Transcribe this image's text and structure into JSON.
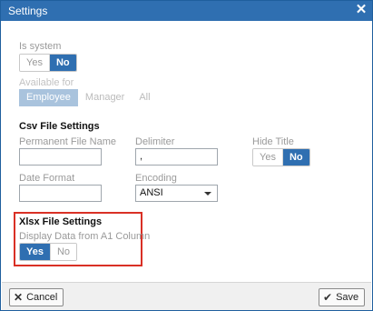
{
  "window": {
    "title": "Settings",
    "close_glyph": "✕"
  },
  "is_system": {
    "label": "Is system",
    "options": [
      "Yes",
      "No"
    ],
    "selected": "No"
  },
  "available_for": {
    "label": "Available for",
    "options": [
      "Employee",
      "Manager",
      "All"
    ],
    "selected": "Employee"
  },
  "csv": {
    "heading": "Csv File Settings",
    "permanent_file_name": {
      "label": "Permanent File Name",
      "value": ""
    },
    "delimiter": {
      "label": "Delimiter",
      "value": ","
    },
    "hide_title": {
      "label": "Hide Title",
      "options": [
        "Yes",
        "No"
      ],
      "selected": "No"
    },
    "date_format": {
      "label": "Date Format",
      "value": ""
    },
    "encoding": {
      "label": "Encoding",
      "value": "ANSI"
    }
  },
  "xlsx": {
    "heading": "Xlsx File Settings",
    "display_from_a1": {
      "label": "Display Data from A1 Column",
      "options": [
        "Yes",
        "No"
      ],
      "selected": "Yes"
    }
  },
  "footer": {
    "cancel_label": "Cancel",
    "cancel_icon": "close-icon",
    "save_label": "Save",
    "save_icon": "checkmark-icon"
  },
  "colors": {
    "accent": "#2f6fb1",
    "highlight_border": "#d93025"
  }
}
